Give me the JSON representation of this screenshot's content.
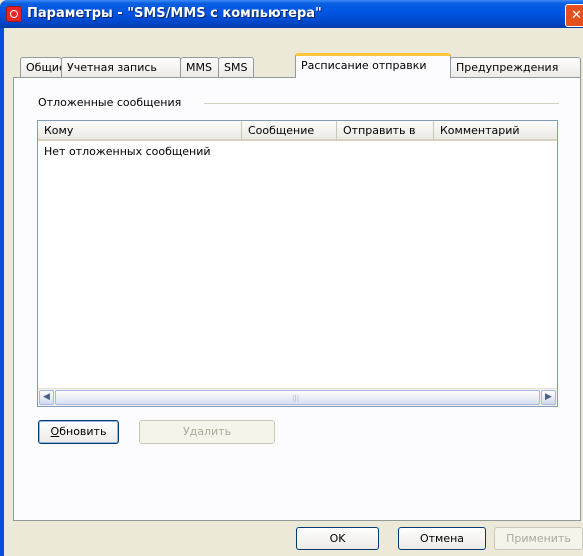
{
  "window": {
    "title": "Параметры - \"SMS/MMS с компьютера\"",
    "close_glyph": "✕"
  },
  "tabs": [
    {
      "label": "Общие",
      "active": false
    },
    {
      "label": "Учетная запись",
      "active": false
    },
    {
      "label": "MMS",
      "active": false
    },
    {
      "label": "SMS",
      "active": false
    },
    {
      "label": "Расписание отправки",
      "active": true
    },
    {
      "label": "Предупреждения",
      "active": false
    }
  ],
  "group": {
    "label": "Отложенные сообщения"
  },
  "list": {
    "columns": [
      "Кому",
      "Сообщение",
      "Отправить в",
      "Комментарий"
    ],
    "empty_text": "Нет отложенных сообщений"
  },
  "actions": {
    "refresh_underline": "О",
    "refresh_rest": "бновить",
    "delete_label": "Удалить"
  },
  "dialog_buttons": {
    "ok": "OK",
    "cancel": "Отмена",
    "apply": "Применить"
  },
  "colors": {
    "titlebar": "#0054e3",
    "active_tab_accent": "#ffc73c",
    "window_background": "#ece9d8"
  }
}
